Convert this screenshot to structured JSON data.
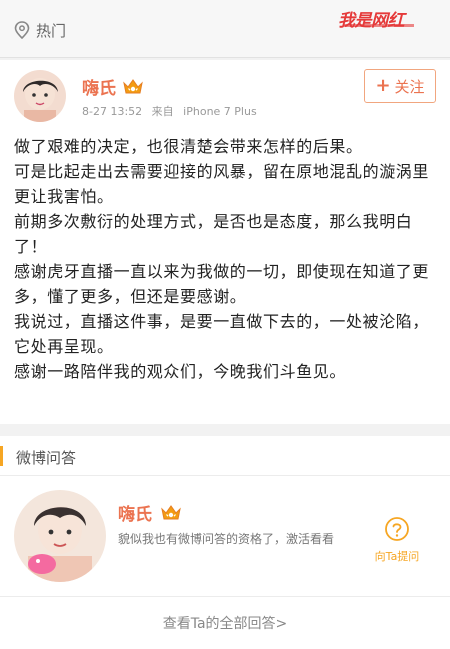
{
  "topbar": {
    "hot_label": "热门",
    "watermark_text": "我是网红"
  },
  "post": {
    "username": "嗨氏",
    "time": "8-27 13:52",
    "source_prefix": "来自",
    "source_device": "iPhone 7 Plus",
    "follow_label": "关注",
    "follow_plus": "+",
    "paragraphs": [
      "做了艰难的决定，也很清楚会带来怎样的后果。",
      "可是比起走出去需要迎接的风暴，留在原地混乱的漩涡里更让我害怕。",
      "前期多次敷衍的处理方式，是否也是态度，那么我明白了！",
      "感谢虎牙直播一直以来为我做的一切，即使现在知道了更多，懂了更多，但还是要感谢。",
      "我说过，直播这件事，是要一直做下去的，一处被沦陷，它处再呈现。",
      "感谢一路陪伴我的观众们，今晚我们斗鱼见。"
    ]
  },
  "qa": {
    "section_title": "微博问答",
    "username": "嗨氏",
    "text": "貌似我也有微博问答的资格了，激活看看",
    "ask_label": "向Ta提问",
    "view_all": "查看Ta的全部回答>"
  },
  "colors": {
    "accent": "#eb7350",
    "section_bar": "#f6a623",
    "watermark": "#e53a3a"
  },
  "icons": {
    "hot": "location-pin-icon",
    "verified": "crown-badge-icon",
    "ask": "question-bubble-icon"
  }
}
